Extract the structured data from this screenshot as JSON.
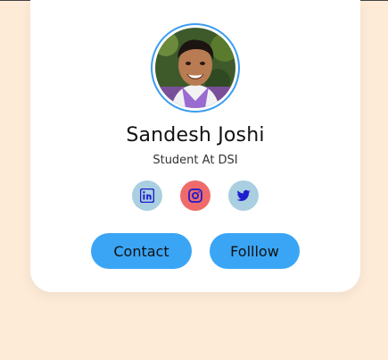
{
  "profile": {
    "name": "Sandesh Joshi",
    "role": "Student At DSI"
  },
  "socials": [
    {
      "name": "linkedin",
      "icon": "linkedin-icon"
    },
    {
      "name": "instagram",
      "icon": "instagram-icon"
    },
    {
      "name": "twitter",
      "icon": "twitter-icon"
    }
  ],
  "actions": {
    "contact_label": "Contact",
    "follow_label": "Folllow"
  },
  "colors": {
    "page_background": "#fdebd8",
    "card_background": "#ffffff",
    "accent": "#3aa5f5",
    "avatar_ring": "#3c9cf0",
    "social_neutral": "#a9cfe0",
    "social_instagram": "#ef6b6b",
    "icon_color": "#1d1dcf"
  }
}
